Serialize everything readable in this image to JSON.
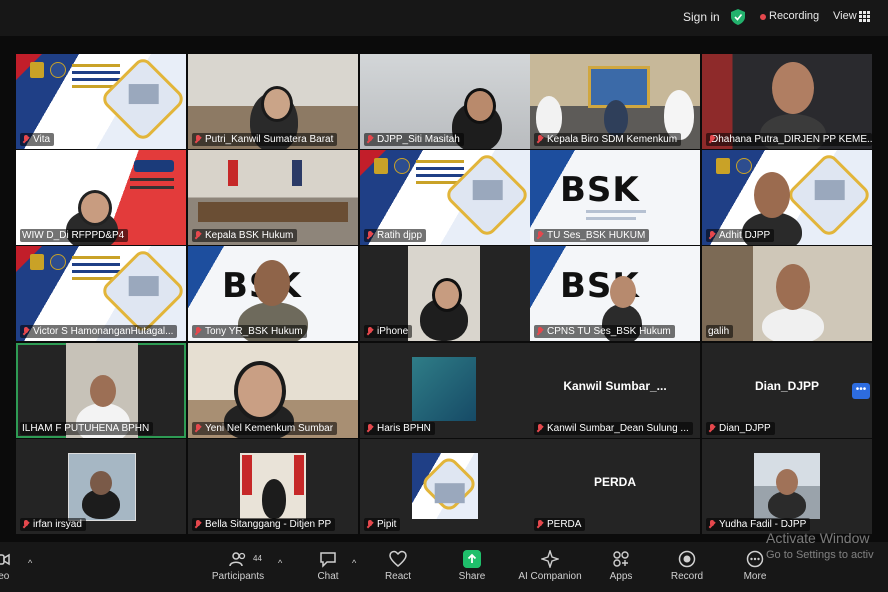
{
  "topbar": {
    "sign_in": "Sign in",
    "recording_label": "Recording",
    "view_label": "View"
  },
  "tiles": [
    {
      "label": "Vita"
    },
    {
      "label": "Putri_Kanwil Sumatera Barat"
    },
    {
      "label": "DJPP_Siti Masitah"
    },
    {
      "label": "Kepala Biro SDM Kemenkum"
    },
    {
      "label": "Dhahana Putra_DIRJEN PP KEME..."
    },
    {
      "label": "WIW D_Di RFPPD&P4"
    },
    {
      "label": "Kepala BSK Hukum"
    },
    {
      "label": "Ratih djpp"
    },
    {
      "label": "TU Ses_BSK HUKUM"
    },
    {
      "label": "Adhit DJPP"
    },
    {
      "label": "Victor S HamonanganHutagal..."
    },
    {
      "label": "Tony YR_BSK Hukum"
    },
    {
      "label": "iPhone"
    },
    {
      "label": "CPNS TU Ses_BSK Hukum"
    },
    {
      "label": "galih"
    },
    {
      "label": "ILHAM F PUTUHENA BPHN"
    },
    {
      "label": "Yeni Nel Kemenkum Sumbar"
    },
    {
      "label": "Haris BPHN"
    },
    {
      "label": "Kanwil Sumbar_Dean Sulung ...",
      "center": "Kanwil  Sumbar_..."
    },
    {
      "label": "Dian_DJPP",
      "center": "Dian_DJPP"
    },
    {
      "label": "irfan irsyad"
    },
    {
      "label": "Bella Sitanggang - Ditjen PP"
    },
    {
      "label": "Pipit"
    },
    {
      "label": "PERDA",
      "center": "PERDA"
    },
    {
      "label": "Yudha Fadil - DJPP"
    }
  ],
  "banner_text": {
    "bsk_logo": "BSK"
  },
  "toolbar": {
    "video": "deo",
    "participants": "Participants",
    "participants_count": "44",
    "chat": "Chat",
    "react": "React",
    "share": "Share",
    "ai_companion": "AI Companion",
    "apps": "Apps",
    "record": "Record",
    "more": "More"
  },
  "watermark": {
    "line1": "Activate Window",
    "line2": "Go to Settings to activ"
  },
  "more_tiles_button": "•••"
}
